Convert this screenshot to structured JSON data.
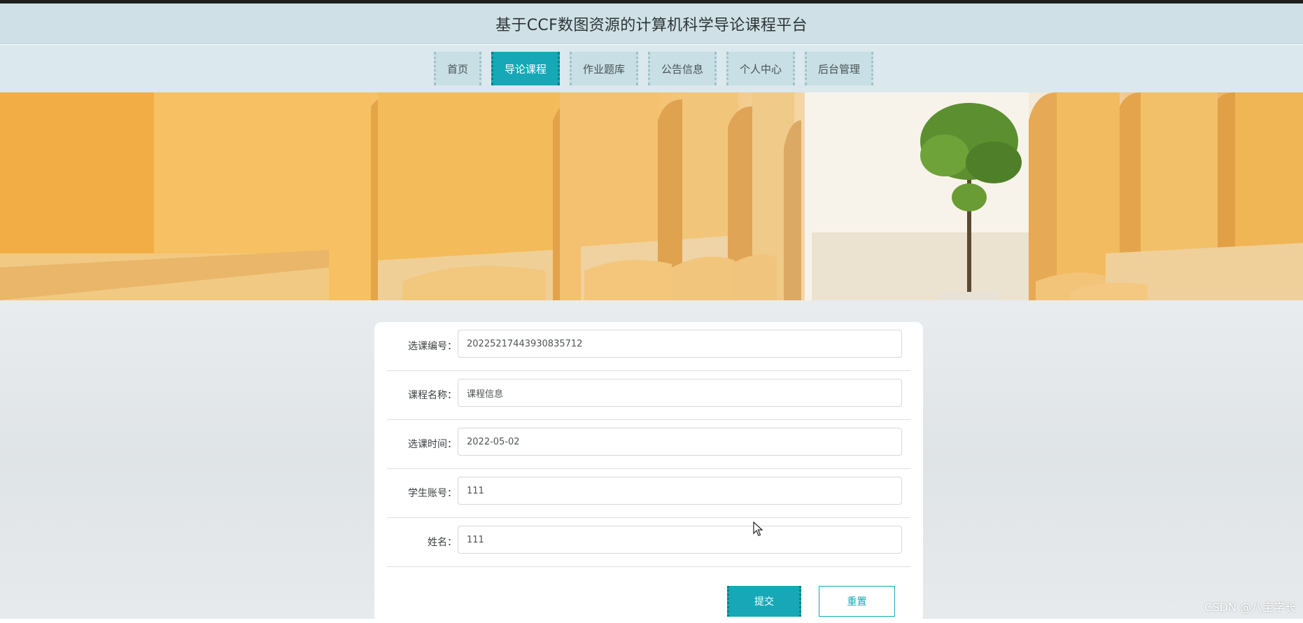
{
  "header": {
    "title": "基于CCF数图资源的计算机科学导论课程平台"
  },
  "nav": {
    "items": [
      {
        "label": "首页"
      },
      {
        "label": "导论课程",
        "active": true
      },
      {
        "label": "作业题库"
      },
      {
        "label": "公告信息"
      },
      {
        "label": "个人中心"
      },
      {
        "label": "后台管理"
      }
    ]
  },
  "form": {
    "fields": [
      {
        "label": "选课编号：",
        "value": "20225217443930835712"
      },
      {
        "label": "课程名称：",
        "value": "课程信息"
      },
      {
        "label": "选课时间：",
        "value": "2022-05-02"
      },
      {
        "label": "学生账号：",
        "value": "111"
      },
      {
        "label": "姓名：",
        "value": "111"
      }
    ],
    "submit_label": "提交",
    "reset_label": "重置"
  },
  "watermark": "CSDN @八宝学长",
  "colors": {
    "accent": "#16a8b6",
    "header_bg": "#cfe1e6",
    "nav_bg": "#dbe8ed",
    "nav_item_bg": "#c7dfe5"
  }
}
